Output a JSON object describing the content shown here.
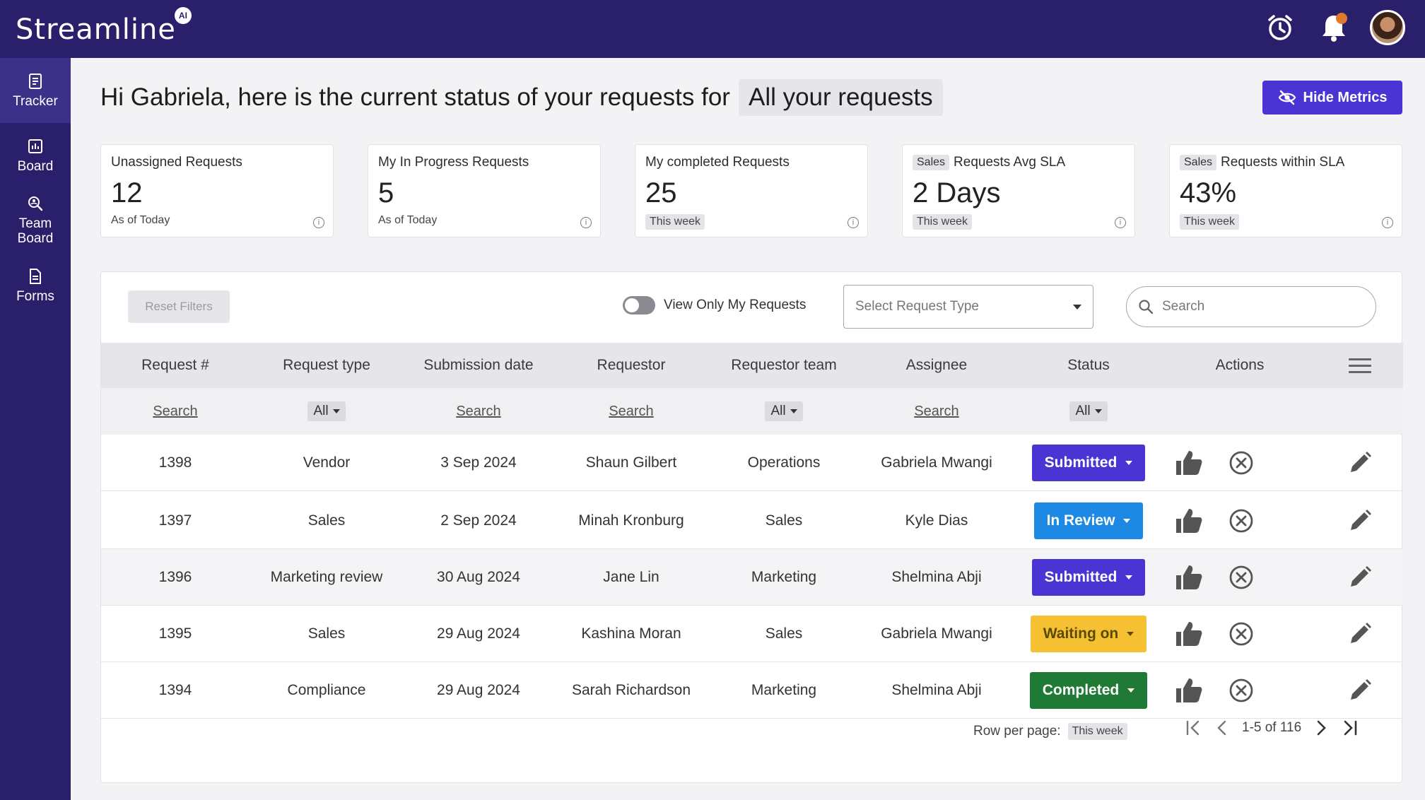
{
  "app": {
    "logo": "Streamline",
    "logo_badge": "AI"
  },
  "sidebar": {
    "items": [
      {
        "label": "Tracker",
        "icon": "tracker-icon",
        "active": true
      },
      {
        "label": "Board",
        "icon": "board-icon",
        "active": false
      },
      {
        "label": "Team Board",
        "icon": "team-board-icon",
        "active": false
      },
      {
        "label": "Forms",
        "icon": "forms-icon",
        "active": false
      }
    ]
  },
  "header": {
    "greeting": "Hi Gabriela, here is the current status of your requests for",
    "scope": "All your requests",
    "hide_metrics_label": "Hide Metrics"
  },
  "metrics": [
    {
      "tag": "",
      "title": "Unassigned Requests",
      "value": "12",
      "sub": "As of Today",
      "sub_chip": false
    },
    {
      "tag": "",
      "title": "My In Progress Requests",
      "value": "5",
      "sub": "As of Today",
      "sub_chip": false
    },
    {
      "tag": "",
      "title": "My completed Requests",
      "value": "25",
      "sub": "This week",
      "sub_chip": true
    },
    {
      "tag": "Sales",
      "title": "Requests Avg SLA",
      "value": "2 Days",
      "sub": "This week",
      "sub_chip": true
    },
    {
      "tag": "Sales",
      "title": "Requests within SLA",
      "value": "43%",
      "sub": "This week",
      "sub_chip": true
    }
  ],
  "filters": {
    "reset_label": "Reset Filters",
    "toggle_label": "View Only My Requests",
    "request_type_placeholder": "Select Request Type",
    "search_placeholder": "Search"
  },
  "table": {
    "headers": [
      "Request #",
      "Request type",
      "Submission date",
      "Requestor",
      "Requestor team",
      "Assignee",
      "Status",
      "Actions"
    ],
    "column_filters": {
      "request_no": "Search",
      "request_type": "All",
      "submission_date": "Search",
      "requestor": "Search",
      "requestor_team": "All",
      "assignee": "Search",
      "status": "All"
    },
    "rows": [
      {
        "id": "1398",
        "type": "Vendor",
        "date": "3 Sep 2024",
        "requestor": "Shaun Gilbert",
        "team": "Operations",
        "assignee": "Gabriela Mwangi",
        "status": "Submitted",
        "status_color": "#4b34d4"
      },
      {
        "id": "1397",
        "type": "Sales",
        "date": "2 Sep 2024",
        "requestor": "Minah Kronburg",
        "team": "Sales",
        "assignee": "Kyle Dias",
        "status": "In Review",
        "status_color": "#1e88e5"
      },
      {
        "id": "1396",
        "type": "Marketing review",
        "date": "30 Aug 2024",
        "requestor": "Jane Lin",
        "team": "Marketing",
        "assignee": "Shelmina Abji",
        "status": "Submitted",
        "status_color": "#4b34d4"
      },
      {
        "id": "1395",
        "type": "Sales",
        "date": "29 Aug 2024",
        "requestor": "Kashina Moran",
        "team": "Sales",
        "assignee": "Gabriela Mwangi",
        "status": "Waiting on",
        "status_color": "#f5c132"
      },
      {
        "id": "1394",
        "type": "Compliance",
        "date": "29 Aug 2024",
        "requestor": "Sarah Richardson",
        "team": "Marketing",
        "assignee": "Shelmina Abji",
        "status": "Completed",
        "status_color": "#1f7a36"
      }
    ]
  },
  "pagination": {
    "rows_per_page_label": "Row per page:",
    "rows_per_page_value": "This week",
    "range": "1-5 of 116"
  }
}
